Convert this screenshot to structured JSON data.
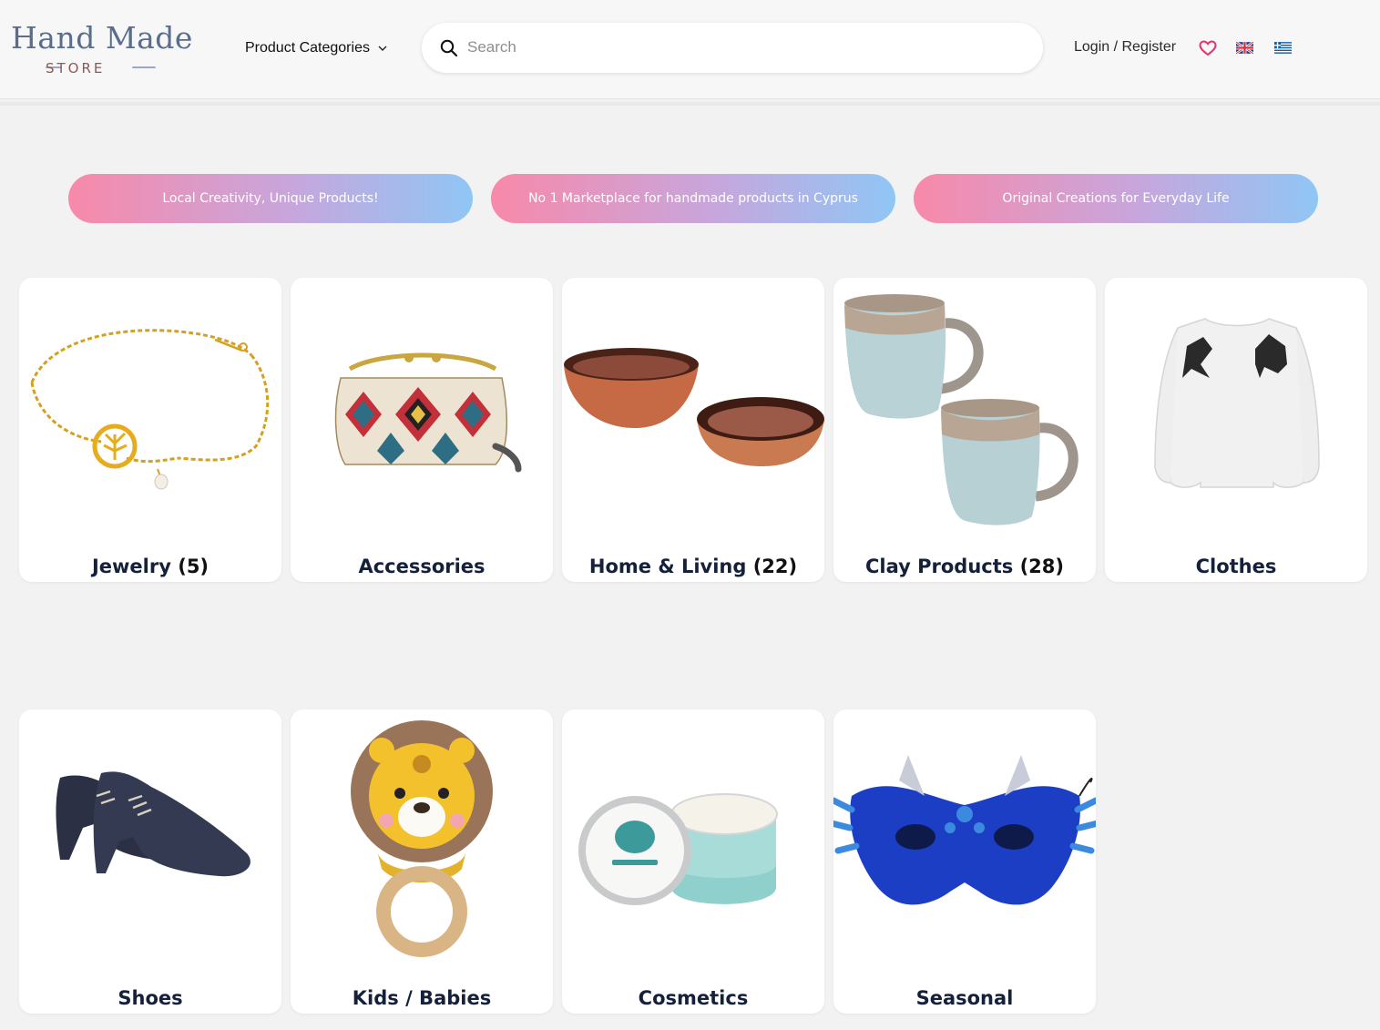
{
  "header": {
    "logo_main": "Hand Made",
    "logo_sub": "STORE",
    "categories_label": "Product Categories",
    "search_placeholder": "Search",
    "login_label": "Login / Register"
  },
  "taglines": [
    {
      "text": "Local Creativity, Unique Products!"
    },
    {
      "text": "No 1 Marketplace for handmade products in Cyprus"
    },
    {
      "text": "Original Creations for Everyday Life"
    }
  ],
  "categories": [
    {
      "name": "Jewelry",
      "count": "(5)",
      "icon": "bracelet-image"
    },
    {
      "name": "Accessories",
      "count": "",
      "icon": "purse-image"
    },
    {
      "name": "Home & Living",
      "count": "(22)",
      "icon": "bowls-image"
    },
    {
      "name": "Clay Products",
      "count": "(28)",
      "icon": "mugs-image"
    },
    {
      "name": "Clothes",
      "count": "",
      "icon": "sweater-image"
    },
    {
      "name": "Shoes",
      "count": "",
      "icon": "shoes-image"
    },
    {
      "name": "Kids / Babies",
      "count": "",
      "icon": "lion-toy-image"
    },
    {
      "name": "Cosmetics",
      "count": "",
      "icon": "cream-jar-image"
    },
    {
      "name": "Seasonal",
      "count": "",
      "icon": "dragon-mask-image"
    }
  ],
  "colors": {
    "pill_gradient_start": "#f889aa",
    "pill_gradient_end": "#8fc6f5",
    "heading_navy": "#15203b",
    "heart_pink": "#e8306a",
    "logo_blue": "#596d8c"
  }
}
